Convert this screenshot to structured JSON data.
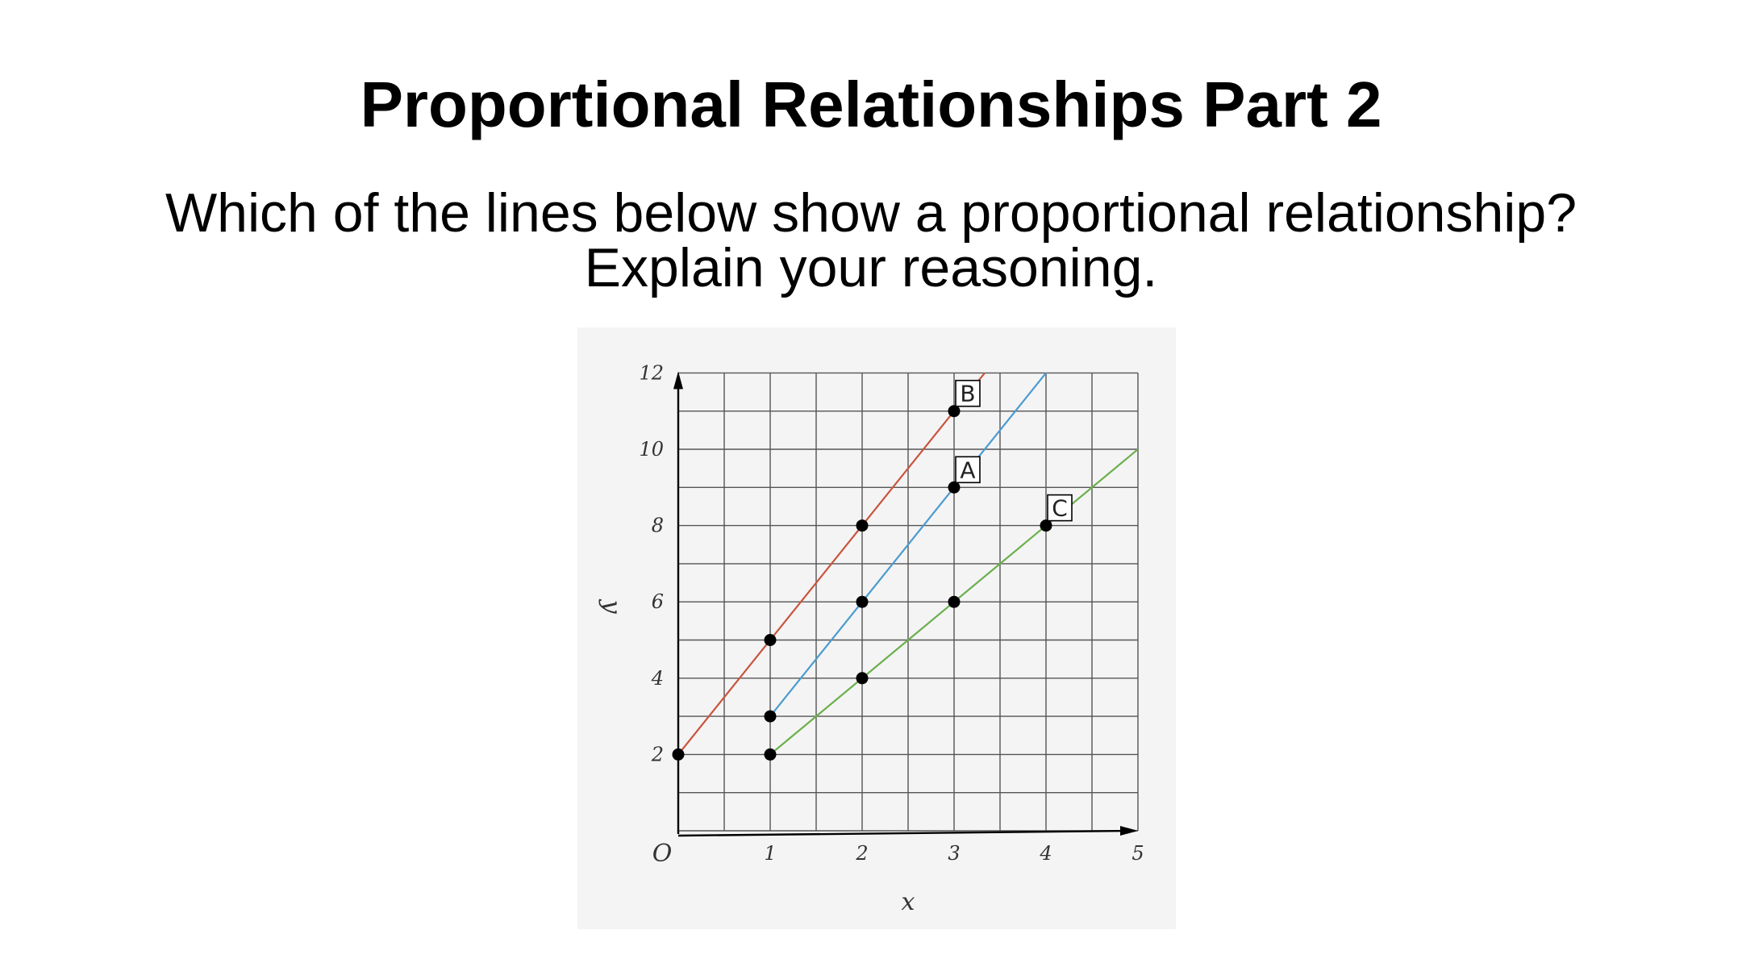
{
  "slide": {
    "title": "Proportional Relationships Part 2",
    "question_line1": "Which of the lines below show a proportional relationship?",
    "question_line2": "Explain your reasoning."
  },
  "chart_data": {
    "type": "line",
    "xlabel": "x",
    "ylabel": "y",
    "xlim": [
      0,
      5
    ],
    "ylim": [
      0,
      12
    ],
    "origin_label": "O",
    "x_ticks": [
      1,
      2,
      3,
      4,
      5
    ],
    "y_ticks": [
      2,
      4,
      6,
      8,
      10,
      12
    ],
    "grid": true,
    "series": [
      {
        "name": "B",
        "color": "#c8553d",
        "line": {
          "slope": 3,
          "intercept": 2
        },
        "points": [
          {
            "x": 0,
            "y": 2
          },
          {
            "x": 1,
            "y": 5
          },
          {
            "x": 2,
            "y": 8
          },
          {
            "x": 3,
            "y": 11
          }
        ]
      },
      {
        "name": "A",
        "color": "#4a9bd0",
        "line": {
          "slope": 3,
          "intercept": 0
        },
        "points": [
          {
            "x": 1,
            "y": 3
          },
          {
            "x": 2,
            "y": 6
          },
          {
            "x": 3,
            "y": 9
          }
        ]
      },
      {
        "name": "C",
        "color": "#6ab04c",
        "line": {
          "slope": 2,
          "intercept": 0
        },
        "points": [
          {
            "x": 1,
            "y": 2
          },
          {
            "x": 2,
            "y": 4
          },
          {
            "x": 3,
            "y": 6
          },
          {
            "x": 4,
            "y": 8
          }
        ]
      }
    ]
  }
}
